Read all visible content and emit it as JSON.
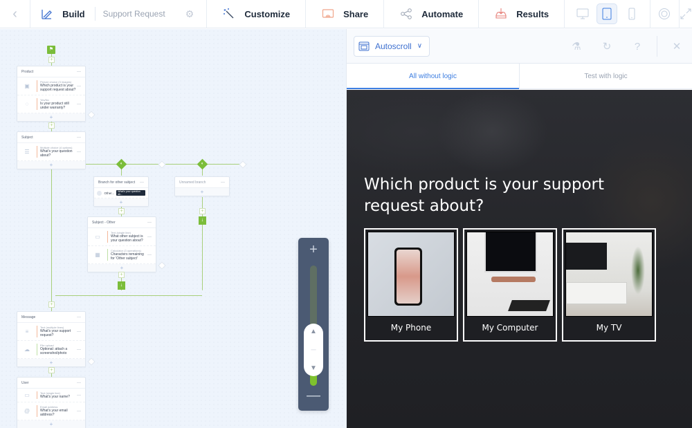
{
  "topbar": {
    "back_icon": "chevron-left-icon",
    "build": {
      "label": "Build",
      "icon": "build-pencil-icon"
    },
    "form_name": "Support Request",
    "settings_icon": "gear-icon",
    "customize": {
      "label": "Customize",
      "icon": "magic-wand-icon"
    },
    "share": {
      "label": "Share",
      "icon": "share-screen-icon"
    },
    "automate": {
      "label": "Automate",
      "icon": "share-nodes-icon"
    },
    "results": {
      "label": "Results",
      "icon": "inbox-download-icon"
    },
    "devices": [
      {
        "name": "desktop",
        "icon": "desktop-icon",
        "active": false
      },
      {
        "name": "tablet",
        "icon": "tablet-icon",
        "active": true
      },
      {
        "name": "phone",
        "icon": "phone-icon",
        "active": false
      }
    ],
    "help_icon": "lifebuoy-icon",
    "expand_icon": "expand-icon"
  },
  "canvas": {
    "start_icon": "start-flag-icon",
    "nodes": [
      {
        "title": "Product",
        "questions": [
          {
            "type": "Picture choice (3 images)",
            "label": "Which product is your support request about?",
            "icon": "image-icon",
            "color": "#f4b89a"
          },
          {
            "type": "Yes/No",
            "label": "Is your product still under warranty?",
            "icon": "chat-question-icon",
            "color": "#f4b89a"
          }
        ]
      },
      {
        "title": "Subject",
        "questions": [
          {
            "type": "Multiple choice (4 options)",
            "label": "What's your question about?",
            "icon": "list-icon",
            "color": "#f4b89a"
          }
        ]
      },
      {
        "title": "Branch for other subject",
        "condition": {
          "label": "Other...",
          "tag": "What's your question ab..."
        }
      },
      {
        "title": "Unnamed branch"
      },
      {
        "title": "Subject - Other",
        "questions": [
          {
            "type": "Text (single line)",
            "label": "What other subject is your question about?",
            "icon": "text-field-icon",
            "color": "#f4b89a"
          },
          {
            "type": "Calculator (3 operations)",
            "label": "Characters remaining for 'Other subject'",
            "icon": "calculator-icon",
            "color": "#bfe0a5"
          }
        ]
      },
      {
        "title": "Message",
        "questions": [
          {
            "type": "Text (multiple lines)",
            "label": "What's your support request?",
            "icon": "textarea-icon",
            "color": "#f4b89a"
          },
          {
            "type": "File upload",
            "label": "Optional: attach a screenshot/photo",
            "icon": "cloud-upload-icon",
            "color": "#bfe0a5"
          }
        ]
      },
      {
        "title": "User",
        "questions": [
          {
            "type": "Text (single line)",
            "label": "What's your name?",
            "icon": "text-field-icon",
            "color": "#f4b89a"
          },
          {
            "type": "Email address",
            "label": "What's your email address?",
            "icon": "at-icon",
            "color": "#f4b89a"
          }
        ]
      }
    ],
    "zoom": {
      "plus": "+",
      "minus": "—",
      "level_fraction": 0.15
    }
  },
  "panel": {
    "autoscroll": {
      "label": "Autoscroll",
      "icon": "autoscroll-icon"
    },
    "tool_icons": [
      "spray-clear-icon",
      "refresh-icon",
      "question-icon",
      "close-icon"
    ],
    "tabs": [
      {
        "label": "All without logic",
        "active": true
      },
      {
        "label": "Test with logic",
        "active": false
      }
    ],
    "preview": {
      "question": "Which product is your support request about?",
      "choices": [
        {
          "label": "My Phone"
        },
        {
          "label": "My Computer"
        },
        {
          "label": "My TV"
        }
      ]
    }
  }
}
